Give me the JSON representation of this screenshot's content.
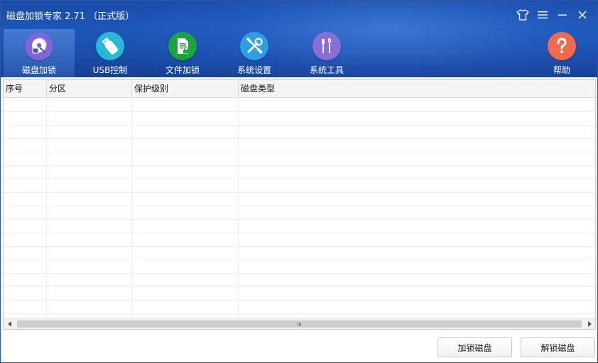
{
  "window": {
    "title": "磁盘加锁专家 2.71 （正式版）"
  },
  "window_controls": {
    "skin": "skin-shirt-icon",
    "menu": "menu-icon",
    "minimize": "minimize-icon",
    "close": "close-icon"
  },
  "toolbar": {
    "items": [
      {
        "label": "磁盘加锁",
        "icon": "disk-lock-icon",
        "color": "#7b68d6",
        "active": true
      },
      {
        "label": "USB控制",
        "icon": "usb-drive-icon",
        "color": "#26b8d8",
        "active": false
      },
      {
        "label": "文件加锁",
        "icon": "file-lock-icon",
        "color": "#1aa63c",
        "active": false
      },
      {
        "label": "系统设置",
        "icon": "tools-cross-icon",
        "color": "#2a9ee6",
        "active": false
      },
      {
        "label": "系统工具",
        "icon": "screwdriver-wrench-icon",
        "color": "#8a6ed8",
        "active": false
      },
      {
        "label": "帮助",
        "icon": "question-mark-icon",
        "color": "#f26a4a",
        "active": false
      }
    ]
  },
  "table": {
    "columns": [
      "序号",
      "分区",
      "保护级别",
      "磁盘类型"
    ],
    "rows": []
  },
  "buttons": {
    "lock": "加锁磁盘",
    "unlock": "解锁磁盘"
  },
  "colors": {
    "header_blue": "#1d56b8",
    "grid_line": "#eeeeee"
  }
}
